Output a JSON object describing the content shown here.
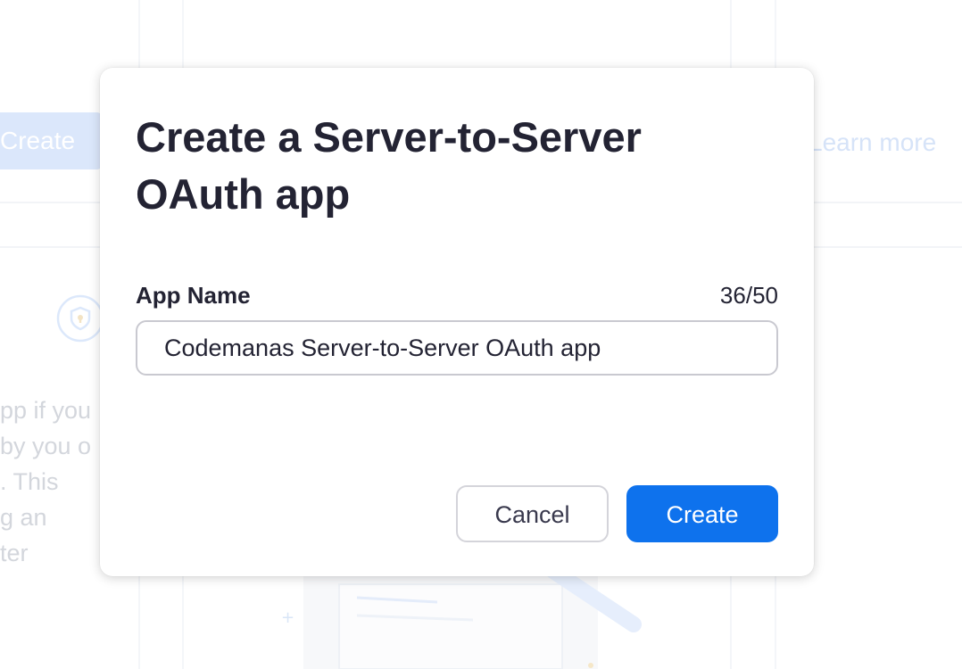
{
  "background": {
    "create_button_label": "Create",
    "learn_more_label": "Learn more",
    "description_fragments": [
      "pp if you",
      "by you o",
      ". This",
      "g an",
      "ter"
    ],
    "shield_icon": "shield-icon"
  },
  "modal": {
    "title": "Create a Server-to-Server OAuth app",
    "app_name_label": "App Name",
    "char_counter": "36/50",
    "app_name_value": "Codemanas Server-to-Server OAuth app",
    "cancel_label": "Cancel",
    "create_label": "Create"
  },
  "colors": {
    "primary": "#0e72ed",
    "text": "#232333",
    "border": "#c9c9d0"
  }
}
